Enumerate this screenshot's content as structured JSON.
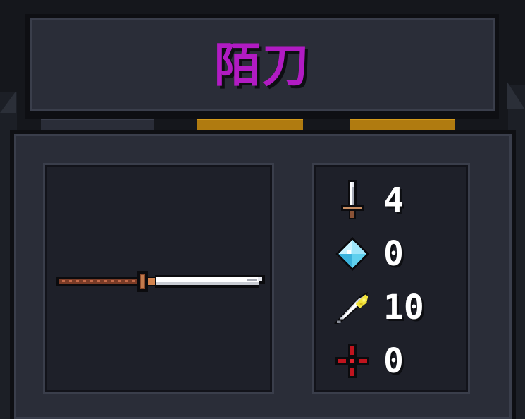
{
  "weapon": {
    "name": "陌刀"
  },
  "tabs": [
    {
      "label": "",
      "active": false,
      "color": "#2a2d38"
    },
    {
      "label": "",
      "active": true,
      "color": "#b07b10"
    },
    {
      "label": "",
      "active": true,
      "color": "#b07b10"
    }
  ],
  "stats": [
    {
      "icon": "sword-icon",
      "value": "4"
    },
    {
      "icon": "energy-crystal-icon",
      "value": "0"
    },
    {
      "icon": "critical-feather-icon",
      "value": "10"
    },
    {
      "icon": "accuracy-crosshair-icon",
      "value": "0"
    }
  ],
  "colors": {
    "title": "#b11bc3",
    "panel": "#2a2d38",
    "slot": "#1e2029",
    "tab_gold": "#b07b10"
  }
}
